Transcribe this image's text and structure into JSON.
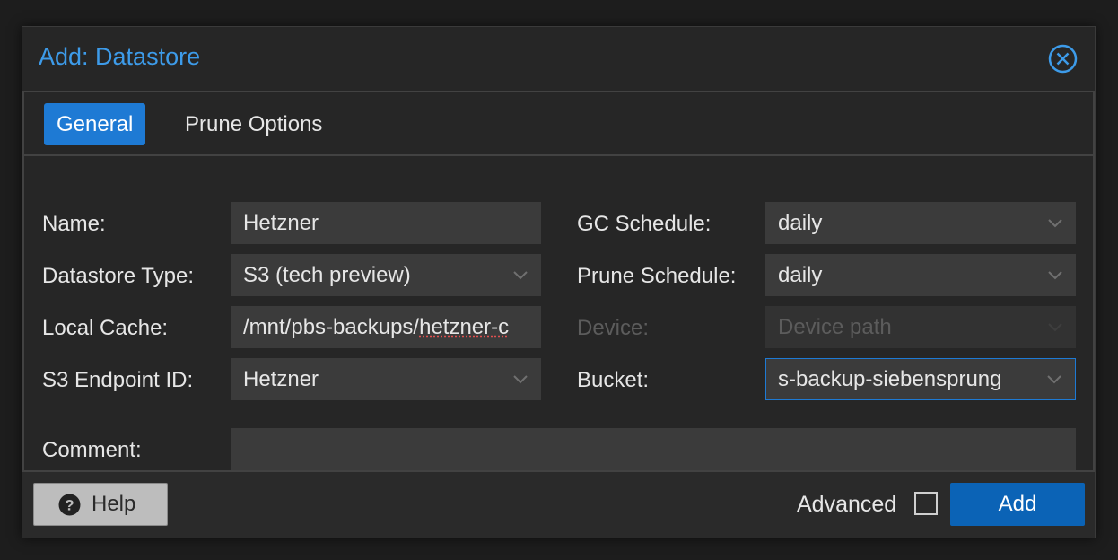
{
  "dialog": {
    "title": "Add: Datastore"
  },
  "tabs": [
    {
      "label": "General",
      "active": true
    },
    {
      "label": "Prune Options",
      "active": false
    }
  ],
  "form": {
    "name": {
      "label": "Name:",
      "value": "Hetzner"
    },
    "datastore_type": {
      "label": "Datastore Type:",
      "value": "S3 (tech preview)"
    },
    "local_cache": {
      "label": "Local Cache:",
      "value": "/mnt/pbs-backups/",
      "value_tail": "hetzner-c"
    },
    "s3_endpoint": {
      "label": "S3 Endpoint ID:",
      "value": "Hetzner"
    },
    "gc_schedule": {
      "label": "GC Schedule:",
      "value": "daily"
    },
    "prune_schedule": {
      "label": "Prune Schedule:",
      "value": "daily"
    },
    "device": {
      "label": "Device:",
      "placeholder": "Device path"
    },
    "bucket": {
      "label": "Bucket:",
      "value": "s-backup-siebensprung"
    },
    "comment": {
      "label": "Comment:",
      "value": ""
    }
  },
  "footer": {
    "help_label": "Help",
    "advanced_label": "Advanced",
    "add_label": "Add"
  },
  "colors": {
    "accent": "#3d9be9",
    "primary_button": "#0b63b6",
    "active_tab": "#1e7ad4"
  }
}
